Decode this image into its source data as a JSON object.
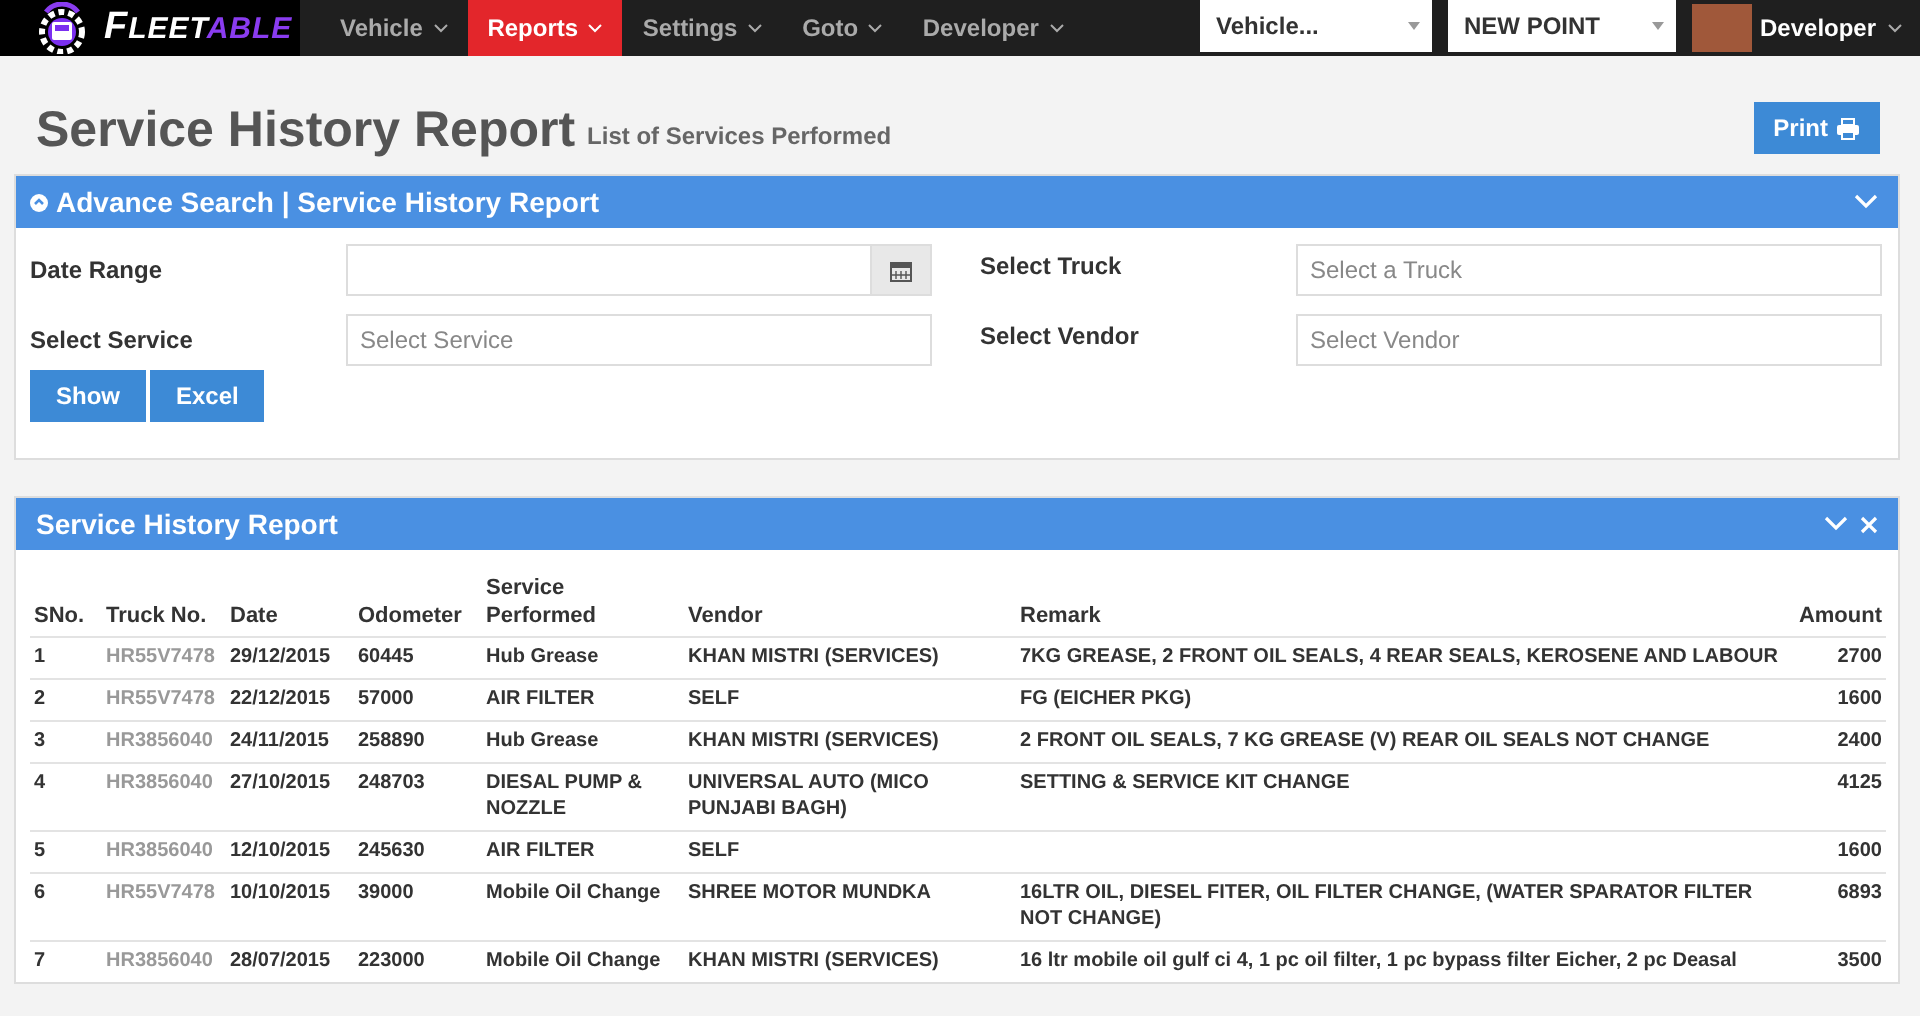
{
  "brand": {
    "name_part_1": "F",
    "name_part_2": "LEET",
    "name_part_3": "ABLE"
  },
  "nav": {
    "items": [
      {
        "label": "Vehicle",
        "selected": false
      },
      {
        "label": "Reports",
        "selected": true
      },
      {
        "label": "Settings",
        "selected": false
      },
      {
        "label": "Goto",
        "selected": false
      },
      {
        "label": "Developer",
        "selected": false
      }
    ],
    "vehicle_select": "Vehicle...",
    "point_select": "NEW POINT",
    "user": "Developer"
  },
  "page": {
    "title": "Service History Report",
    "subtitle": "List of Services Performed",
    "print_button": "Print"
  },
  "search_panel": {
    "title": "Advance Search | Service History Report",
    "date_range_label": "Date Range",
    "truck_label": "Select Truck",
    "truck_placeholder": "Select a Truck",
    "service_label": "Select Service",
    "service_placeholder": "Select Service",
    "vendor_label": "Select Vendor",
    "vendor_placeholder": "Select Vendor",
    "buttons": [
      "Show",
      "Excel"
    ]
  },
  "report_panel": {
    "title": "Service History Report",
    "table": {
      "columns": [
        "SNo.",
        "Truck No.",
        "Date",
        "Odometer",
        "Service Performed",
        "Vendor",
        "Remark",
        "Amount"
      ],
      "rows": [
        [
          "1",
          "HR55V7478",
          "29/12/2015",
          "60445",
          "Hub Grease",
          "KHAN MISTRI (SERVICES)",
          "7KG GREASE, 2 FRONT OIL SEALS, 4 REAR SEALS, KEROSENE AND LABOUR",
          "2700"
        ],
        [
          "2",
          "HR55V7478",
          "22/12/2015",
          "57000",
          "AIR FILTER",
          "SELF",
          "FG (EICHER PKG)",
          "1600"
        ],
        [
          "3",
          "HR3856040",
          "24/11/2015",
          "258890",
          "Hub Grease",
          "KHAN MISTRI (SERVICES)",
          "2 FRONT OIL SEALS, 7 KG GREASE (V) REAR OIL SEALS NOT CHANGE",
          "2400"
        ],
        [
          "4",
          "HR3856040",
          "27/10/2015",
          "248703",
          "DIESAL PUMP & NOZZLE",
          "UNIVERSAL AUTO (MICO PUNJABI BAGH)",
          "SETTING & SERVICE KIT CHANGE",
          "4125"
        ],
        [
          "5",
          "HR3856040",
          "12/10/2015",
          "245630",
          "AIR FILTER",
          "SELF",
          "",
          "1600"
        ],
        [
          "6",
          "HR55V7478",
          "10/10/2015",
          "39000",
          "Mobile Oil Change",
          "SHREE MOTOR MUNDKA",
          "16LTR OIL, DIESEL FITER, OIL FILTER CHANGE, (WATER SPARATOR FILTER NOT CHANGE)",
          "6893"
        ],
        [
          "7",
          "HR3856040",
          "28/07/2015",
          "223000",
          "Mobile Oil Change",
          "KHAN MISTRI (SERVICES)",
          "16 ltr mobile oil gulf ci 4, 1 pc oil filter, 1 pc bypass filter Eicher, 2 pc Deasal",
          "3500"
        ]
      ]
    }
  }
}
